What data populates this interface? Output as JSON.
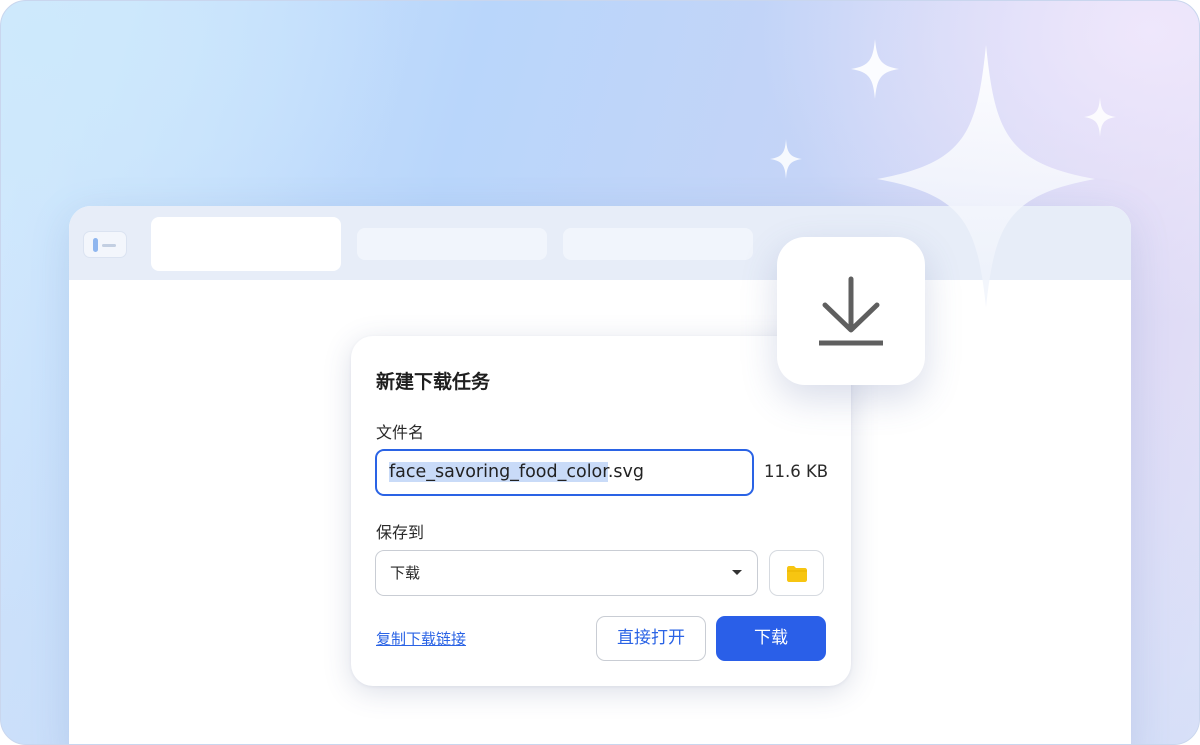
{
  "dialog": {
    "title": "新建下载任务",
    "filename_label": "文件名",
    "filename_selected": "face_savoring_food_color",
    "filename_ext": ".svg",
    "file_size": "11.6 KB",
    "save_to_label": "保存到",
    "save_to_value": "下载",
    "copy_link_label": "复制下载链接",
    "open_label": "直接打开",
    "download_label": "下载"
  },
  "icons": {
    "badge": "download-arrow-icon",
    "folder": "folder-icon",
    "dropdown": "chevron-down-icon",
    "sidebar": "sidebar-toggle-icon"
  },
  "colors": {
    "accent": "#2a5fe8",
    "folder": "#f7c511",
    "selection": "#c9dbf8"
  }
}
